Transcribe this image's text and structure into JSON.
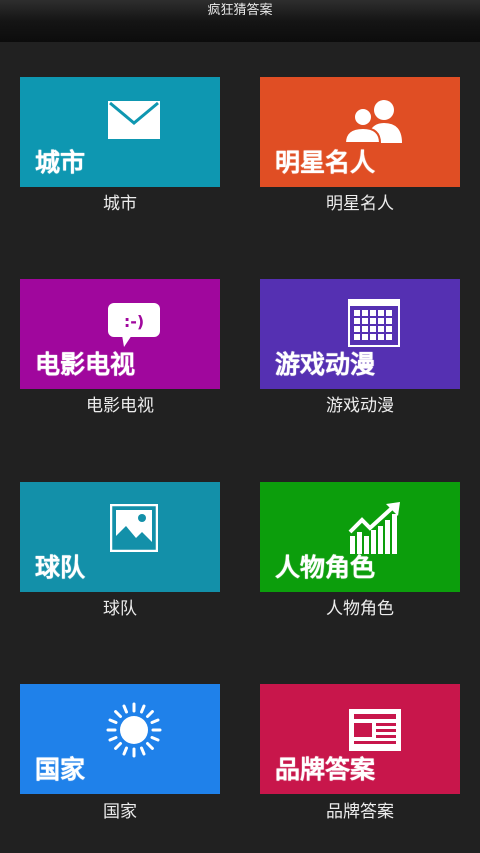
{
  "header": {
    "title": "疯狂猜答案"
  },
  "categories": [
    {
      "tile_text": "城市",
      "caption": "城市",
      "color": "#0e97b1",
      "icon": "mail-icon"
    },
    {
      "tile_text": "明星名人",
      "caption": "明星名人",
      "color": "#e04e24",
      "icon": "people-icon"
    },
    {
      "tile_text": "电影电视",
      "caption": "电影电视",
      "color": "#a0079d",
      "icon": "chat-bubble-icon"
    },
    {
      "tile_text": "游戏动漫",
      "caption": "游戏动漫",
      "color": "#5530b2",
      "icon": "calendar-icon"
    },
    {
      "tile_text": "球队",
      "caption": "球队",
      "color": "#1390a9",
      "icon": "picture-icon"
    },
    {
      "tile_text": "人物角色",
      "caption": "人物角色",
      "color": "#0c9e0c",
      "icon": "chart-icon"
    },
    {
      "tile_text": "国家",
      "caption": "国家",
      "color": "#1f81ea",
      "icon": "sun-icon"
    },
    {
      "tile_text": "品牌答案",
      "caption": "品牌答案",
      "color": "#c8164b",
      "icon": "newspaper-icon"
    }
  ]
}
